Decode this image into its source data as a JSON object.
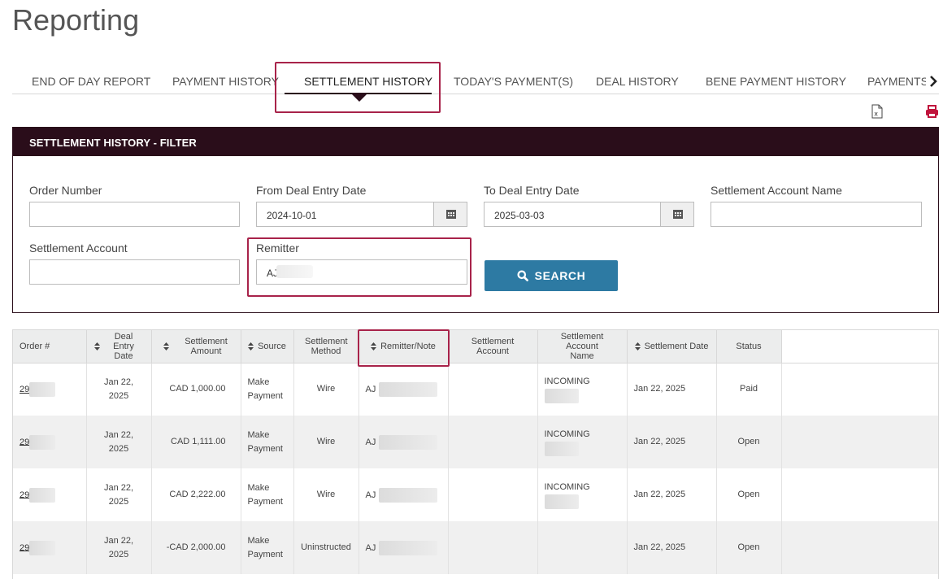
{
  "page": {
    "title": "Reporting"
  },
  "tabs": [
    {
      "label": "END OF DAY REPORT"
    },
    {
      "label": "PAYMENT HISTORY"
    },
    {
      "label": "SETTLEMENT HISTORY",
      "active": true
    },
    {
      "label": "TODAY'S PAYMENT(S)"
    },
    {
      "label": "DEAL HISTORY"
    },
    {
      "label": "BENE PAYMENT HISTORY"
    },
    {
      "label": "PAYMENTS I"
    }
  ],
  "toolbar": {
    "export_icon": "excel-export-icon",
    "print_icon": "print-icon"
  },
  "filter": {
    "title": "SETTLEMENT HISTORY - FILTER",
    "order_number": {
      "label": "Order Number",
      "value": ""
    },
    "from_date": {
      "label": "From Deal Entry Date",
      "value": "2024-10-01"
    },
    "to_date": {
      "label": "To Deal Entry Date",
      "value": "2025-03-03"
    },
    "settlement_account_name": {
      "label": "Settlement Account Name",
      "value": ""
    },
    "settlement_account": {
      "label": "Settlement Account",
      "value": ""
    },
    "remitter": {
      "label": "Remitter",
      "value": "AJ"
    },
    "search_label": "SEARCH"
  },
  "table": {
    "headers": {
      "order": "Order #",
      "deal_entry_date": "Deal Entry Date",
      "settlement_amount": "Settlement Amount",
      "source": "Source",
      "settlement_method": "Settlement Method",
      "remitter_note": "Remitter/Note",
      "settlement_account": "Settlement Account",
      "settlement_account_name": "Settlement Account Name",
      "settlement_date": "Settlement Date",
      "status": "Status"
    },
    "rows": [
      {
        "order": "29",
        "deal_date": "Jan 22, 2025",
        "amount": "CAD 1,000.00",
        "source": "Make Payment",
        "method": "Wire",
        "remitter": "AJ",
        "account": "",
        "account_name": "INCOMING",
        "settlement_date": "Jan 22, 2025",
        "status": "Paid"
      },
      {
        "order": "29",
        "deal_date": "Jan 22, 2025",
        "amount": "CAD 1,111.00",
        "source": "Make Payment",
        "method": "Wire",
        "remitter": "AJ",
        "account": "",
        "account_name": "INCOMING",
        "settlement_date": "Jan 22, 2025",
        "status": "Open"
      },
      {
        "order": "29",
        "deal_date": "Jan 22, 2025",
        "amount": "CAD 2,222.00",
        "source": "Make Payment",
        "method": "Wire",
        "remitter": "AJ",
        "account": "",
        "account_name": "INCOMING",
        "settlement_date": "Jan 22, 2025",
        "status": "Open"
      },
      {
        "order": "29",
        "deal_date": "Jan 22, 2025",
        "amount": "-CAD 2,000.00",
        "source": "Make Payment",
        "method": "Uninstructed",
        "remitter": "AJ",
        "account": "",
        "account_name": "",
        "settlement_date": "Jan 22, 2025",
        "status": "Open"
      }
    ]
  },
  "colors": {
    "brand_dark": "#2a0d1a",
    "highlight": "#a8234a",
    "search_button": "#2d7aa3",
    "print_icon": "#c0143c"
  }
}
